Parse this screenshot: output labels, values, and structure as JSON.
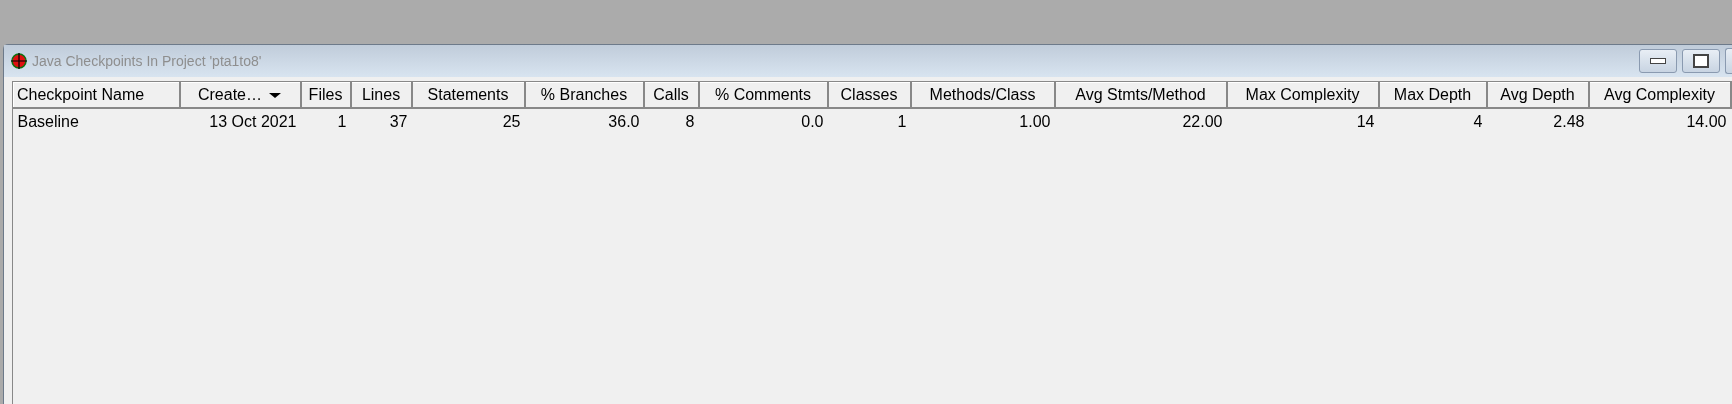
{
  "window": {
    "title": "Java Checkpoints In Project 'pta1to8'"
  },
  "table": {
    "columns": [
      {
        "label": "Checkpoint Name",
        "sorted": false
      },
      {
        "label": "Create…",
        "sorted": true
      },
      {
        "label": "Files",
        "sorted": false
      },
      {
        "label": "Lines",
        "sorted": false
      },
      {
        "label": "Statements",
        "sorted": false
      },
      {
        "label": "% Branches",
        "sorted": false
      },
      {
        "label": "Calls",
        "sorted": false
      },
      {
        "label": "% Comments",
        "sorted": false
      },
      {
        "label": "Classes",
        "sorted": false
      },
      {
        "label": "Methods/Class",
        "sorted": false
      },
      {
        "label": "Avg Stmts/Method",
        "sorted": false
      },
      {
        "label": "Max Complexity",
        "sorted": false
      },
      {
        "label": "Max Depth",
        "sorted": false
      },
      {
        "label": "Avg Depth",
        "sorted": false
      },
      {
        "label": "Avg Complexity",
        "sorted": false
      }
    ],
    "rows": [
      {
        "cells": [
          "Baseline",
          "13 Oct 2021",
          "1",
          "37",
          "25",
          "36.0",
          "8",
          "0.0",
          "1",
          "1.00",
          "22.00",
          "14",
          "4",
          "2.48",
          "14.00"
        ]
      }
    ]
  }
}
